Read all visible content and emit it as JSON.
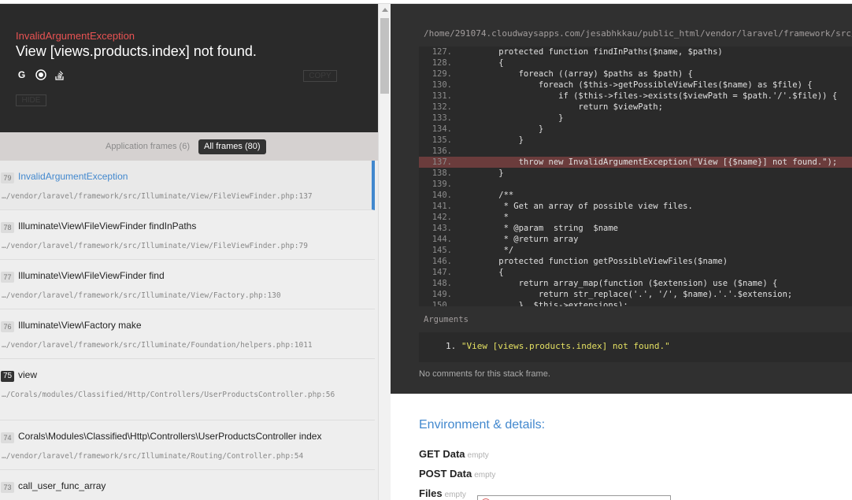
{
  "header": {
    "exception_class": "InvalidArgumentException",
    "message": "View [views.products.index] not found.",
    "icons": [
      "google-icon",
      "duckduckgo-icon",
      "stackoverflow-icon"
    ],
    "copy_label": "COPY",
    "hide_label": "HIDE"
  },
  "filters": {
    "application": "Application frames (6)",
    "all": "All frames (80)"
  },
  "frames": [
    {
      "num": "79",
      "cls": "InvalidArgumentException",
      "file": "…/vendor/laravel/framework/src/Illuminate/View/FileViewFinder.php:137"
    },
    {
      "num": "78",
      "cls": "Illuminate\\View\\FileViewFinder findInPaths",
      "file": "…/vendor/laravel/framework/src/Illuminate/View/FileViewFinder.php:79"
    },
    {
      "num": "77",
      "cls": "Illuminate\\View\\FileViewFinder find",
      "file": "…/vendor/laravel/framework/src/Illuminate/View/Factory.php:130"
    },
    {
      "num": "76",
      "cls": "Illuminate\\View\\Factory make",
      "file": "…/vendor/laravel/framework/src/Illuminate/Foundation/helpers.php:1011"
    },
    {
      "num": "75",
      "cls": "view",
      "file": "…/Corals/modules/Classified/Http/Controllers/UserProductsController.php:56"
    },
    {
      "num": "74",
      "cls": "Corals\\Modules\\Classified\\Http\\Controllers\\UserProductsController index",
      "file": "…/vendor/laravel/framework/src/Illuminate/Routing/Controller.php:54"
    },
    {
      "num": "73",
      "cls": "call_user_func_array",
      "file": ""
    }
  ],
  "code": {
    "filepath": "/home/291074.cloudwaysapps.com/jesabhkkau/public_html/vendor/laravel/framework/src/Illuminate/View/FileViewFinder.php",
    "lines": [
      {
        "n": "127.",
        "t": "    protected function findInPaths($name, $paths)"
      },
      {
        "n": "128.",
        "t": "    {"
      },
      {
        "n": "129.",
        "t": "        foreach ((array) $paths as $path) {"
      },
      {
        "n": "130.",
        "t": "            foreach ($this->getPossibleViewFiles($name) as $file) {"
      },
      {
        "n": "131.",
        "t": "                if ($this->files->exists($viewPath = $path.'/'.$file)) {"
      },
      {
        "n": "132.",
        "t": "                    return $viewPath;"
      },
      {
        "n": "133.",
        "t": "                }"
      },
      {
        "n": "134.",
        "t": "            }"
      },
      {
        "n": "135.",
        "t": "        }"
      },
      {
        "n": "136.",
        "t": ""
      },
      {
        "n": "137.",
        "t": "        throw new InvalidArgumentException(\"View [{$name}] not found.\");"
      },
      {
        "n": "138.",
        "t": "    }"
      },
      {
        "n": "139.",
        "t": ""
      },
      {
        "n": "140.",
        "t": "    /**"
      },
      {
        "n": "141.",
        "t": "     * Get an array of possible view files."
      },
      {
        "n": "142.",
        "t": "     *"
      },
      {
        "n": "143.",
        "t": "     * @param  string  $name"
      },
      {
        "n": "144.",
        "t": "     * @return array"
      },
      {
        "n": "145.",
        "t": "     */"
      },
      {
        "n": "146.",
        "t": "    protected function getPossibleViewFiles($name)"
      },
      {
        "n": "147.",
        "t": "    {"
      },
      {
        "n": "148.",
        "t": "        return array_map(function ($extension) use ($name) {"
      },
      {
        "n": "149.",
        "t": "            return str_replace('.', '/', $name).'.'.$extension;"
      },
      {
        "n": "150.",
        "t": "        }, $this->extensions);"
      }
    ],
    "highlight_line": "137."
  },
  "arguments": {
    "label": "Arguments",
    "item_num": "1.",
    "item_value": "\"View [views.products.index] not found.\""
  },
  "comments": "No comments for this stack frame.",
  "environment": {
    "title": "Environment & details:",
    "rows": [
      {
        "label": "GET Data",
        "value": "empty"
      },
      {
        "label": "POST Data",
        "value": "empty"
      },
      {
        "label": "Files",
        "value": "empty"
      }
    ]
  },
  "colors": {
    "accent": "#4288ce",
    "exception_red": "#e95353",
    "highlight_bg": "#6b3c3c"
  }
}
